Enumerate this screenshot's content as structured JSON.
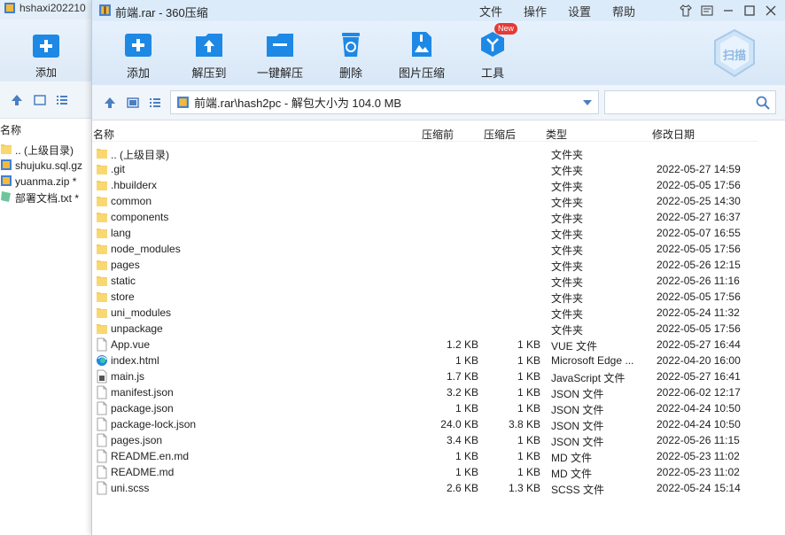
{
  "background_window": {
    "title": "hshaxi202210",
    "add_label": "添加",
    "col_name": "名称",
    "items": [
      {
        "name": ".. (上级目录)",
        "icon": "folder-icon"
      },
      {
        "name": "shujuku.sql.gz",
        "icon": "archive-icon"
      },
      {
        "name": "yuanma.zip *",
        "icon": "archive-icon"
      },
      {
        "name": "部署文档.txt *",
        "icon": "text-file-icon"
      }
    ]
  },
  "window": {
    "title": "前端.rar - 360压缩",
    "menu": [
      "文件",
      "操作",
      "设置",
      "帮助"
    ]
  },
  "toolbar": {
    "buttons": [
      {
        "label": "添加",
        "icon": "add-icon"
      },
      {
        "label": "解压到",
        "icon": "extract-to-icon"
      },
      {
        "label": "一键解压",
        "icon": "one-click-extract-icon"
      },
      {
        "label": "删除",
        "icon": "delete-icon"
      },
      {
        "label": "图片压缩",
        "icon": "image-compress-icon"
      },
      {
        "label": "工具",
        "icon": "tools-icon"
      }
    ],
    "new_badge": "New",
    "scan_label": "扫描"
  },
  "nav": {
    "path": "前端.rar\\hash2pc - 解包大小为 104.0 MB",
    "search_placeholder": ""
  },
  "columns": {
    "name": "名称",
    "size": "压缩前",
    "compressed": "压缩后",
    "type": "类型",
    "date": "修改日期"
  },
  "files": [
    {
      "name": ".. (上级目录)",
      "size": "",
      "csize": "",
      "type": "文件夹",
      "date": "",
      "icon": "folder"
    },
    {
      "name": ".git",
      "size": "",
      "csize": "",
      "type": "文件夹",
      "date": "2022-05-27 14:59",
      "icon": "folder"
    },
    {
      "name": ".hbuilderx",
      "size": "",
      "csize": "",
      "type": "文件夹",
      "date": "2022-05-05 17:56",
      "icon": "folder"
    },
    {
      "name": "common",
      "size": "",
      "csize": "",
      "type": "文件夹",
      "date": "2022-05-25 14:30",
      "icon": "folder"
    },
    {
      "name": "components",
      "size": "",
      "csize": "",
      "type": "文件夹",
      "date": "2022-05-27 16:37",
      "icon": "folder"
    },
    {
      "name": "lang",
      "size": "",
      "csize": "",
      "type": "文件夹",
      "date": "2022-05-07 16:55",
      "icon": "folder"
    },
    {
      "name": "node_modules",
      "size": "",
      "csize": "",
      "type": "文件夹",
      "date": "2022-05-05 17:56",
      "icon": "folder"
    },
    {
      "name": "pages",
      "size": "",
      "csize": "",
      "type": "文件夹",
      "date": "2022-05-26 12:15",
      "icon": "folder"
    },
    {
      "name": "static",
      "size": "",
      "csize": "",
      "type": "文件夹",
      "date": "2022-05-26 11:16",
      "icon": "folder"
    },
    {
      "name": "store",
      "size": "",
      "csize": "",
      "type": "文件夹",
      "date": "2022-05-05 17:56",
      "icon": "folder"
    },
    {
      "name": "uni_modules",
      "size": "",
      "csize": "",
      "type": "文件夹",
      "date": "2022-05-24 11:32",
      "icon": "folder"
    },
    {
      "name": "unpackage",
      "size": "",
      "csize": "",
      "type": "文件夹",
      "date": "2022-05-05 17:56",
      "icon": "folder"
    },
    {
      "name": "App.vue",
      "size": "1.2 KB",
      "csize": "1 KB",
      "type": "VUE 文件",
      "date": "2022-05-27 16:44",
      "icon": "file"
    },
    {
      "name": "index.html",
      "size": "1 KB",
      "csize": "1 KB",
      "type": "Microsoft Edge ...",
      "date": "2022-04-20 16:00",
      "icon": "edge"
    },
    {
      "name": "main.js",
      "size": "1.7 KB",
      "csize": "1 KB",
      "type": "JavaScript 文件",
      "date": "2022-05-27 16:41",
      "icon": "js"
    },
    {
      "name": "manifest.json",
      "size": "3.2 KB",
      "csize": "1 KB",
      "type": "JSON 文件",
      "date": "2022-06-02 12:17",
      "icon": "file"
    },
    {
      "name": "package.json",
      "size": "1 KB",
      "csize": "1 KB",
      "type": "JSON 文件",
      "date": "2022-04-24 10:50",
      "icon": "file"
    },
    {
      "name": "package-lock.json",
      "size": "24.0 KB",
      "csize": "3.8 KB",
      "type": "JSON 文件",
      "date": "2022-04-24 10:50",
      "icon": "file"
    },
    {
      "name": "pages.json",
      "size": "3.4 KB",
      "csize": "1 KB",
      "type": "JSON 文件",
      "date": "2022-05-26 11:15",
      "icon": "file"
    },
    {
      "name": "README.en.md",
      "size": "1 KB",
      "csize": "1 KB",
      "type": "MD 文件",
      "date": "2022-05-23 11:02",
      "icon": "file"
    },
    {
      "name": "README.md",
      "size": "1 KB",
      "csize": "1 KB",
      "type": "MD 文件",
      "date": "2022-05-23 11:02",
      "icon": "file"
    },
    {
      "name": "uni.scss",
      "size": "2.6 KB",
      "csize": "1.3 KB",
      "type": "SCSS 文件",
      "date": "2022-05-24 15:14",
      "icon": "file"
    }
  ],
  "colors": {
    "titlebar": "#dcebfa",
    "toolbar_icon": "#1e88e5",
    "folder": "#f6cd5c"
  }
}
